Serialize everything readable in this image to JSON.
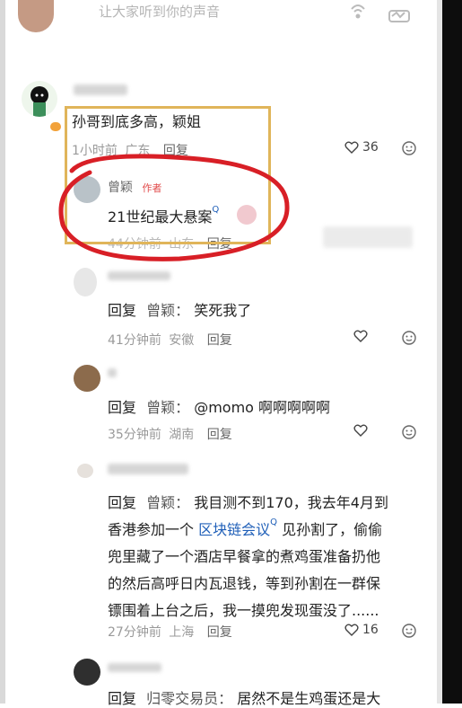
{
  "top_comment": {
    "text": "让大家听到你的声音"
  },
  "comment1": {
    "text": "孙哥到底多高，颖姐",
    "time": "1小时前",
    "location": "广东",
    "reply": "回复",
    "likes": "36"
  },
  "author_reply": {
    "name": "曾颖",
    "badge": "作者",
    "text": "21世纪最大悬案",
    "time": "44分钟前",
    "location": "山东",
    "reply": "回复"
  },
  "replies": [
    {
      "prefix": "回复",
      "target": "曾颖：",
      "text": "笑死我了",
      "time": "41分钟前",
      "location": "安徽",
      "reply": "回复"
    },
    {
      "prefix": "回复",
      "target": "曾颖：",
      "text": "@momo 啊啊啊啊啊",
      "time": "35分钟前",
      "location": "湖南",
      "reply": "回复"
    },
    {
      "prefix": "回复",
      "target": "曾颖：",
      "line1": "我目测不到170，我去年4月到",
      "line2_a": "香港参加一个",
      "line2_link": "区块链会议",
      "line2_b": "见孙割了，偷偷",
      "line3": "兜里藏了一个酒店早餐拿的煮鸡蛋准备扔他",
      "line4": "的然后高呼日内瓦退钱，等到孙割在一群保",
      "line5": "镖围着上台之后，我一摸兜发现蛋没了......",
      "time": "27分钟前",
      "location": "上海",
      "reply": "回复",
      "likes": "16"
    },
    {
      "prefix": "回复",
      "target": "归零交易员：",
      "text": "居然不是生鸡蛋还是大"
    }
  ]
}
